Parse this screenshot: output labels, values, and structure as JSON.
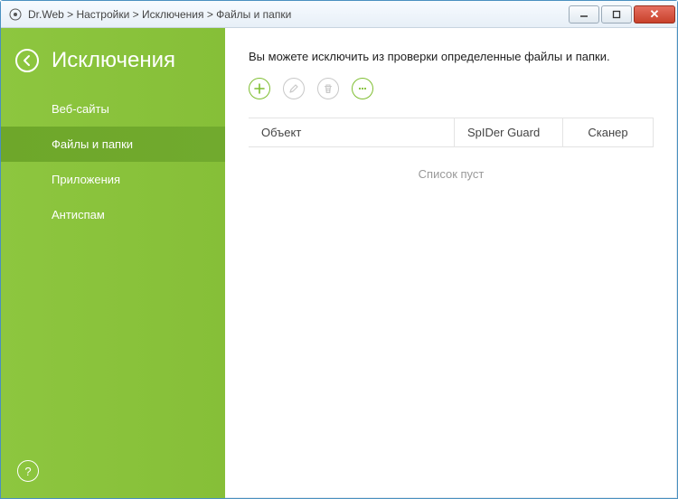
{
  "window": {
    "breadcrumb": "Dr.Web > Настройки > Исключения > Файлы и папки"
  },
  "sidebar": {
    "title": "Исключения",
    "items": [
      {
        "label": "Веб-сайты",
        "active": false
      },
      {
        "label": "Файлы и папки",
        "active": true
      },
      {
        "label": "Приложения",
        "active": false
      },
      {
        "label": "Антиспам",
        "active": false
      }
    ],
    "help_label": "?"
  },
  "main": {
    "description": "Вы можете исключить из проверки определенные файлы и папки.",
    "toolbar": {
      "add": {
        "name": "add",
        "enabled": true
      },
      "edit": {
        "name": "edit",
        "enabled": false
      },
      "delete": {
        "name": "delete",
        "enabled": false
      },
      "more": {
        "name": "more",
        "enabled": true
      }
    },
    "table": {
      "columns": {
        "object": "Объект",
        "spider": "SpIDer Guard",
        "scanner": "Сканер"
      },
      "empty_text": "Список пуст",
      "rows": []
    }
  },
  "colors": {
    "accent": "#8ac33b",
    "accent_dark": "#6fa32c"
  }
}
